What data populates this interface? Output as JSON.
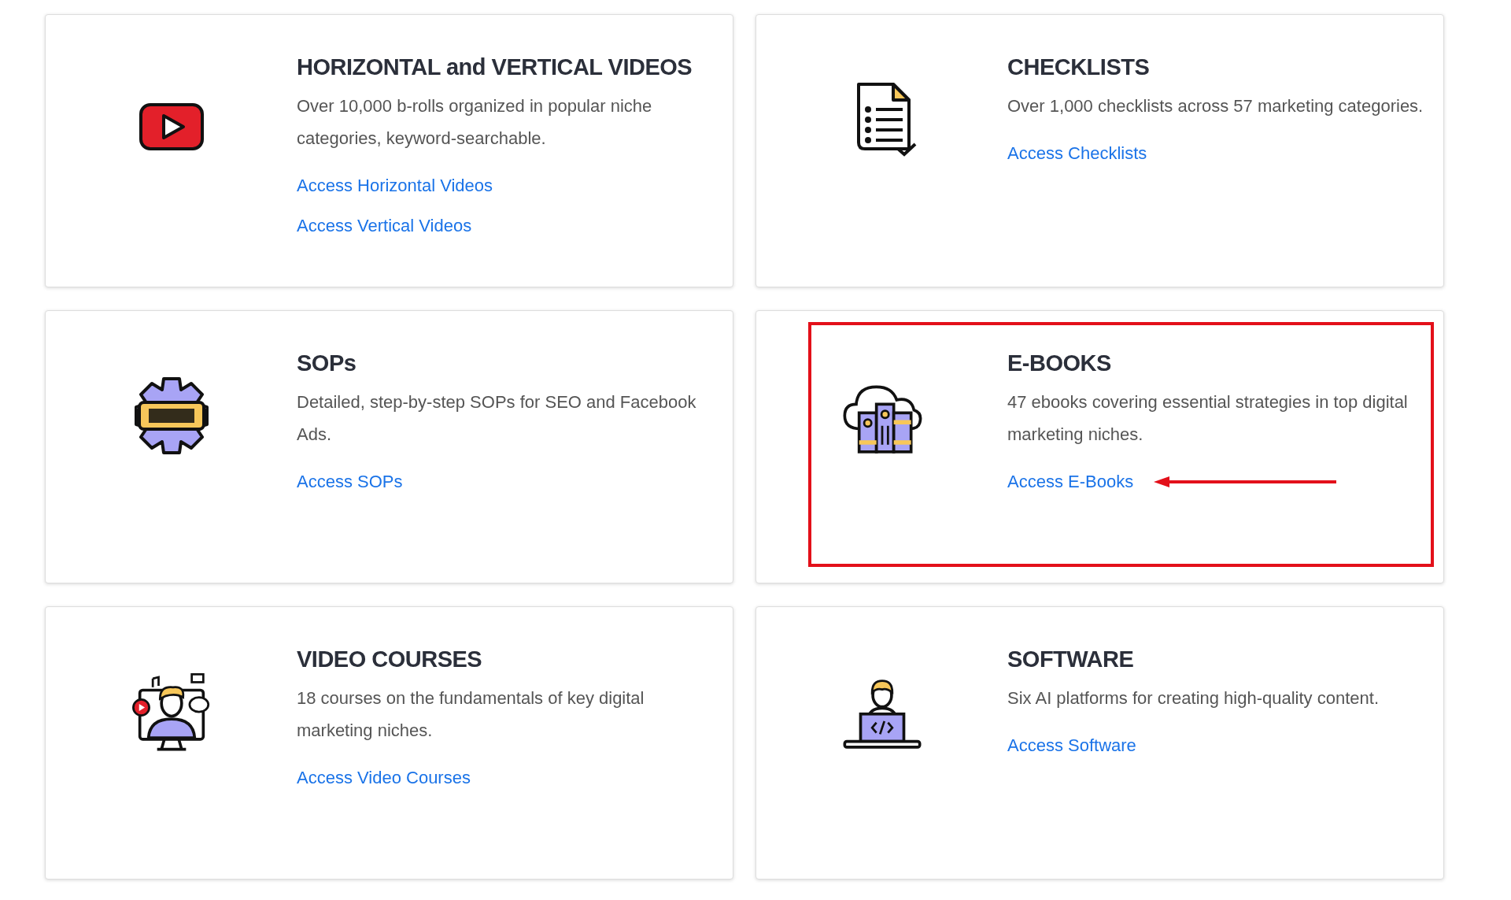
{
  "cards": [
    {
      "kind": "video",
      "title": "HORIZONTAL and VERTICAL VIDEOS",
      "description": "Over 10,000 b-rolls organized in popular niche categories, keyword-searchable.",
      "links": [
        "Access Horizontal Videos",
        "Access Vertical Videos"
      ],
      "highlighted": false
    },
    {
      "kind": "checklist",
      "title": "CHECKLISTS",
      "description": "Over 1,000 checklists across 57 marketing categories.",
      "links": [
        "Access Checklists"
      ],
      "highlighted": false
    },
    {
      "kind": "sop",
      "title": "SOPs",
      "description": "Detailed, step-by-step SOPs for SEO and Facebook Ads.",
      "links": [
        "Access SOPs"
      ],
      "highlighted": false
    },
    {
      "kind": "ebooks",
      "title": "E-BOOKS",
      "description": "47 ebooks covering essential strategies in top digital marketing niches.",
      "links": [
        "Access E-Books"
      ],
      "highlighted": true
    },
    {
      "kind": "courses",
      "title": "VIDEO COURSES",
      "description": "18 courses on the fundamentals of key digital marketing niches.",
      "links": [
        "Access Video Courses"
      ],
      "highlighted": false
    },
    {
      "kind": "software",
      "title": "SOFTWARE",
      "description": "Six AI platforms for creating high-quality content.",
      "links": [
        "Access Software"
      ],
      "highlighted": false
    }
  ]
}
